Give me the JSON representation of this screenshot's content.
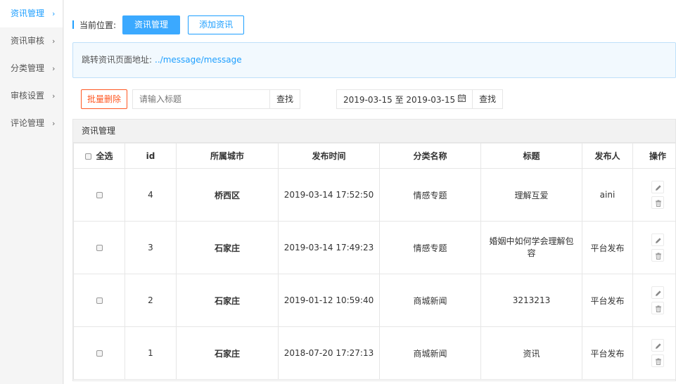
{
  "sidebar": {
    "items": [
      {
        "label": "资讯管理",
        "active": true
      },
      {
        "label": "资讯审核",
        "active": false
      },
      {
        "label": "分类管理",
        "active": false
      },
      {
        "label": "审核设置",
        "active": false
      },
      {
        "label": "评论管理",
        "active": false
      }
    ],
    "chevron": "›"
  },
  "breadcrumb": {
    "label": "当前位置:",
    "current": "资讯管理",
    "add_button": "添加资讯"
  },
  "notice": {
    "text": "跳转资讯页面地址:",
    "link": "../message/message"
  },
  "toolbar": {
    "batch_delete": "批量删除",
    "search_placeholder": "请输入标题",
    "search_button": "查找",
    "date_range": "2019-03-15 至 2019-03-15",
    "date_search_button": "查找"
  },
  "panel": {
    "title": "资讯管理"
  },
  "table": {
    "headers": {
      "select_all": "全选",
      "id": "id",
      "city": "所属城市",
      "time": "发布时间",
      "category": "分类名称",
      "title": "标题",
      "publisher": "发布人",
      "actions": "操作"
    },
    "rows": [
      {
        "id": "4",
        "city": "桥西区",
        "time": "2019-03-14 17:52:50",
        "category": "情感专题",
        "title": "理解互爱",
        "publisher": "aini"
      },
      {
        "id": "3",
        "city": "石家庄",
        "time": "2019-03-14 17:49:23",
        "category": "情感专题",
        "title": "婚姻中如何学会理解包容",
        "publisher": "平台发布"
      },
      {
        "id": "2",
        "city": "石家庄",
        "time": "2019-01-12 10:59:40",
        "category": "商城新闻",
        "title": "3213213",
        "publisher": "平台发布"
      },
      {
        "id": "1",
        "city": "石家庄",
        "time": "2018-07-20 17:27:13",
        "category": "商城新闻",
        "title": "资讯",
        "publisher": "平台发布"
      }
    ]
  },
  "icons": {
    "calendar": "calendar-icon",
    "edit": "pencil-icon",
    "delete": "trash-icon"
  },
  "colors": {
    "primary": "#1e9fff",
    "danger": "#ff5722"
  }
}
